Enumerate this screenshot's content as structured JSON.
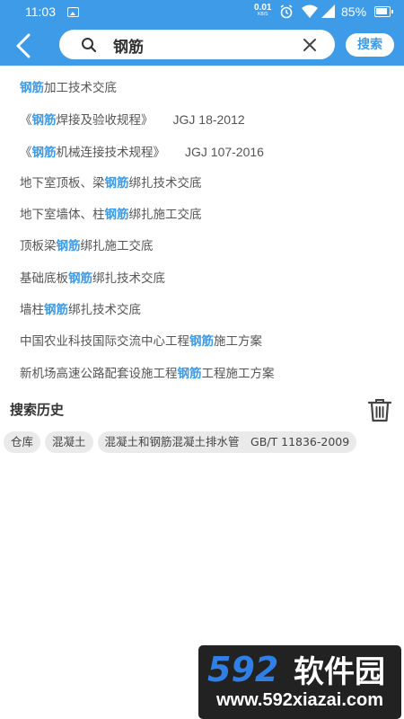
{
  "status_bar": {
    "time": "11:03",
    "net_speed_value": "0.01",
    "net_speed_unit": "KB/S",
    "battery": "85%"
  },
  "header": {
    "query": "钢筋",
    "search_button": "搜索"
  },
  "suggestions": [
    {
      "before": "",
      "highlight": "钢筋",
      "after": "加工技术交底",
      "code": ""
    },
    {
      "before": "《",
      "highlight": "钢筋",
      "after": "焊接及验收规程》",
      "code": "JGJ 18-2012"
    },
    {
      "before": "《",
      "highlight": "钢筋",
      "after": "机械连接技术规程》",
      "code": "JGJ 107-2016"
    },
    {
      "before": "地下室顶板、梁",
      "highlight": "钢筋",
      "after": "绑扎技术交底",
      "code": ""
    },
    {
      "before": "地下室墙体、柱",
      "highlight": "钢筋",
      "after": "绑扎施工交底",
      "code": ""
    },
    {
      "before": "顶板梁",
      "highlight": "钢筋",
      "after": "绑扎施工交底",
      "code": ""
    },
    {
      "before": "基础底板",
      "highlight": "钢筋",
      "after": "绑扎技术交底",
      "code": ""
    },
    {
      "before": "墙柱",
      "highlight": "钢筋",
      "after": "绑扎技术交底",
      "code": ""
    },
    {
      "before": "中国农业科技国际交流中心工程",
      "highlight": "钢筋",
      "after": "施工方案",
      "code": ""
    },
    {
      "before": "新机场高速公路配套设施工程",
      "highlight": "钢筋",
      "after": "工程施工方案",
      "code": ""
    }
  ],
  "history": {
    "title": "搜索历史",
    "tags": [
      "仓库",
      "混凝土",
      "混凝土和钢筋混凝土排水管　GB/T 11836-2009"
    ]
  },
  "watermark": {
    "logo_text": "592软件园",
    "url": "www.592xiazai.com"
  },
  "colors": {
    "accent": "#3d9be8",
    "text": "#555555",
    "tag_bg": "#eaeaea"
  }
}
